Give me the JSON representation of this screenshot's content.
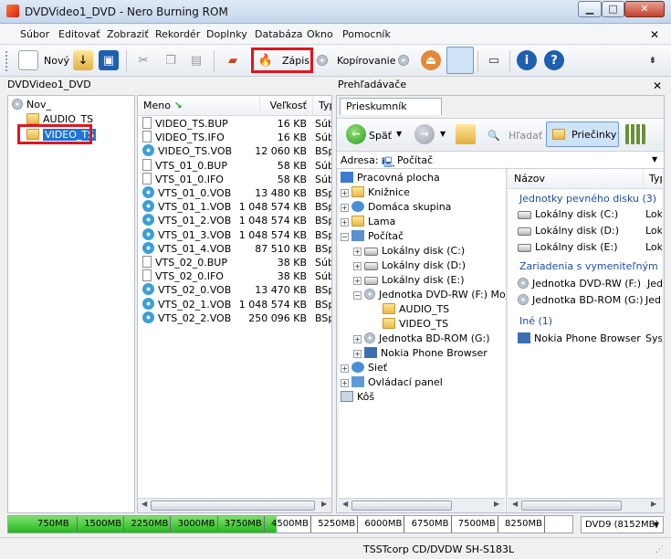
{
  "window": {
    "title": "DVDVideo1_DVD - Nero Burning ROM"
  },
  "menu": [
    "Súbor",
    "Editovať",
    "Zobraziť",
    "Rekordér",
    "Doplnky",
    "Databáza",
    "Okno",
    "Pomocník"
  ],
  "toolbar": {
    "new_label": "Nový",
    "burn_label": "Zápis",
    "copy_label": "Kopírovanie"
  },
  "left_pane": {
    "header": "DVDVideo1_DVD",
    "tree": [
      "Nov_",
      "AUDIO_TS",
      "VIDEO_TS"
    ]
  },
  "file_list": {
    "columns": [
      "Meno",
      "Veľkosť",
      "Typ"
    ],
    "rows": [
      {
        "name": "VIDEO_TS.BUP",
        "size": "16 KB",
        "type": "Súb"
      },
      {
        "name": "VIDEO_TS.IFO",
        "size": "16 KB",
        "type": "Súb"
      },
      {
        "name": "VIDEO_TS.VOB",
        "size": "12 060 KB",
        "type": "BSp"
      },
      {
        "name": "VTS_01_0.BUP",
        "size": "58 KB",
        "type": "Súb"
      },
      {
        "name": "VTS_01_0.IFO",
        "size": "58 KB",
        "type": "Súb"
      },
      {
        "name": "VTS_01_0.VOB",
        "size": "13 480 KB",
        "type": "BSp"
      },
      {
        "name": "VTS_01_1.VOB",
        "size": "1 048 574 KB",
        "type": "BSp"
      },
      {
        "name": "VTS_01_2.VOB",
        "size": "1 048 574 KB",
        "type": "BSp"
      },
      {
        "name": "VTS_01_3.VOB",
        "size": "1 048 574 KB",
        "type": "BSp"
      },
      {
        "name": "VTS_01_4.VOB",
        "size": "87 510 KB",
        "type": "BSp"
      },
      {
        "name": "VTS_02_0.BUP",
        "size": "38 KB",
        "type": "Súb"
      },
      {
        "name": "VTS_02_0.IFO",
        "size": "38 KB",
        "type": "Súb"
      },
      {
        "name": "VTS_02_0.VOB",
        "size": "13 470 KB",
        "type": "BSp"
      },
      {
        "name": "VTS_02_1.VOB",
        "size": "1 048 574 KB",
        "type": "BSp"
      },
      {
        "name": "VTS_02_2.VOB",
        "size": "250 096 KB",
        "type": "BSp"
      }
    ]
  },
  "browser": {
    "header": "Prehľadávače",
    "tab": "Prieskumník súborov",
    "back_label": "Späť",
    "search_label": "Hľadať",
    "folders_label": "Priečinky",
    "address_label": "Adresa:",
    "address_value": "Počítač",
    "tree": [
      "Pracovná plocha",
      "Knižnice",
      "Domáca skupina",
      "Lama",
      "Počítač",
      "Lokálny disk (C:)",
      "Lokálny disk (D:)",
      "Lokálny disk (E:)",
      "Jednotka DVD-RW (F:) Mojse",
      "AUDIO_TS",
      "VIDEO_TS",
      "Jednotka BD-ROM (G:)",
      "Nokia Phone Browser",
      "Sieť",
      "Ovládací panel",
      "Kôš"
    ],
    "list_columns": [
      "Názov",
      "Typ"
    ],
    "groups": [
      {
        "title": "Jednotky pevného disku (3)",
        "items": [
          {
            "name": "Lokálny disk (C:)",
            "type": "Lok"
          },
          {
            "name": "Lokálny disk (D:)",
            "type": "Lok"
          },
          {
            "name": "Lokálny disk (E:)",
            "type": "Lok"
          }
        ]
      },
      {
        "title": "Zariadenia s vymeniteľným ukladacím",
        "items": [
          {
            "name": "Jednotka DVD-RW (F:) ...",
            "type": "Jed"
          },
          {
            "name": "Jednotka BD-ROM (G:)",
            "type": "Jed"
          }
        ]
      },
      {
        "title": "Iné (1)",
        "items": [
          {
            "name": "Nokia Phone Browser",
            "type": "Sys"
          }
        ]
      }
    ]
  },
  "capacity": {
    "used_fraction": 0.475,
    "ticks": [
      "750MB",
      "1500MB",
      "2250MB",
      "3000MB",
      "3750MB",
      "4500MB",
      "5250MB",
      "6000MB",
      "6750MB",
      "7500MB",
      "8250MB"
    ],
    "disc_type": "DVD9 (8152MB)"
  },
  "status": {
    "drive": "TSSTcorp CD/DVDW SH-S183L"
  }
}
